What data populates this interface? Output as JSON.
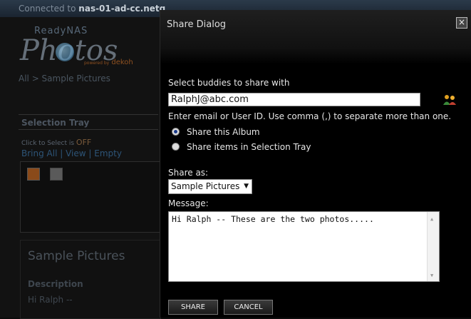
{
  "background": {
    "status_prefix": "Connected to ",
    "status_host": "nas-01-ad-cc.netg",
    "logo": {
      "brand": "ReadyNAS",
      "name": "Photos",
      "powered_by": "powered by",
      "dekoh": "dekoh"
    },
    "breadcrumb": "All > Sample Pictures",
    "selection_tray": {
      "title": "Selection Tray",
      "click_to_select": "Click to Select is",
      "off": "OFF",
      "links": {
        "bring_all": "Bring All",
        "view": "View",
        "empty": "Empty"
      }
    },
    "album": {
      "title": "Sample Pictures",
      "description_label": "Description",
      "description": "Hi Ralph --"
    }
  },
  "dialog": {
    "title": "Share Dialog",
    "close": "×",
    "buddies_label": "Select buddies to share with",
    "buddies_value": "RalphJ@abc.com",
    "hint": "Enter email or User ID. Use comma (,) to separate more than one.",
    "options": [
      {
        "label": "Share this Album",
        "selected": true
      },
      {
        "label": "Share items in Selection Tray",
        "selected": false
      }
    ],
    "share_as_label": "Share as:",
    "share_as_value": "Sample Pictures",
    "message_label": "Message:",
    "message_value": "Hi Ralph -- These are the two photos.....",
    "share_button": "SHARE",
    "cancel_button": "CANCEL"
  }
}
